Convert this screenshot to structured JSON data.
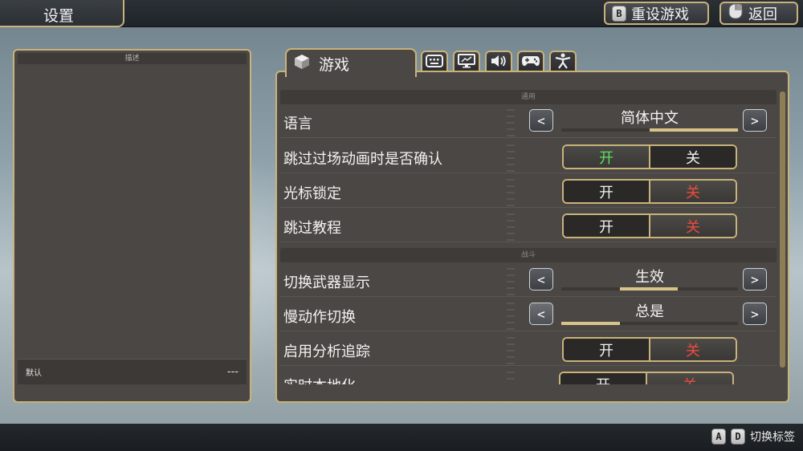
{
  "header": {
    "title": "设置",
    "reset_key": "B",
    "reset_label": "重设游戏",
    "back_label": "返回"
  },
  "description_panel": {
    "header": "描述",
    "default_label": "默认",
    "default_value": "---"
  },
  "tabs": {
    "active_label": "游戏",
    "icons": [
      "keyboard-icon",
      "monitor-icon",
      "speaker-icon",
      "gamepad-icon",
      "accessibility-icon"
    ]
  },
  "sections": [
    {
      "header": "通用"
    },
    {
      "header": "战斗"
    }
  ],
  "settings": [
    {
      "label": "语言",
      "type": "select",
      "value": "简体中文",
      "fill": [
        0.5,
        1.0
      ]
    },
    {
      "label": "跳过过场动画时是否确认",
      "type": "toggle",
      "on": "开",
      "off": "关",
      "selected": "on"
    },
    {
      "label": "光标锁定",
      "type": "toggle",
      "on": "开",
      "off": "关",
      "selected": "off"
    },
    {
      "label": "跳过教程",
      "type": "toggle",
      "on": "开",
      "off": "关",
      "selected": "off"
    },
    {
      "label": "切换武器显示",
      "type": "select",
      "value": "生效",
      "fill": [
        0.33,
        0.66
      ]
    },
    {
      "label": "慢动作切换",
      "type": "select",
      "value": "总是",
      "fill": [
        0.0,
        0.33
      ]
    },
    {
      "label": "启用分析追踪",
      "type": "toggle",
      "on": "开",
      "off": "关",
      "selected": "off"
    },
    {
      "label": "实时本地化",
      "type": "toggle",
      "on": "开",
      "off": "关",
      "selected": "off"
    }
  ],
  "footer": {
    "key_a": "A",
    "key_d": "D",
    "hint": "切换标签"
  },
  "colors": {
    "accent": "#c9b37a",
    "on": "#5de15d",
    "off": "#ef4a3f",
    "panel": "#4a4744"
  }
}
